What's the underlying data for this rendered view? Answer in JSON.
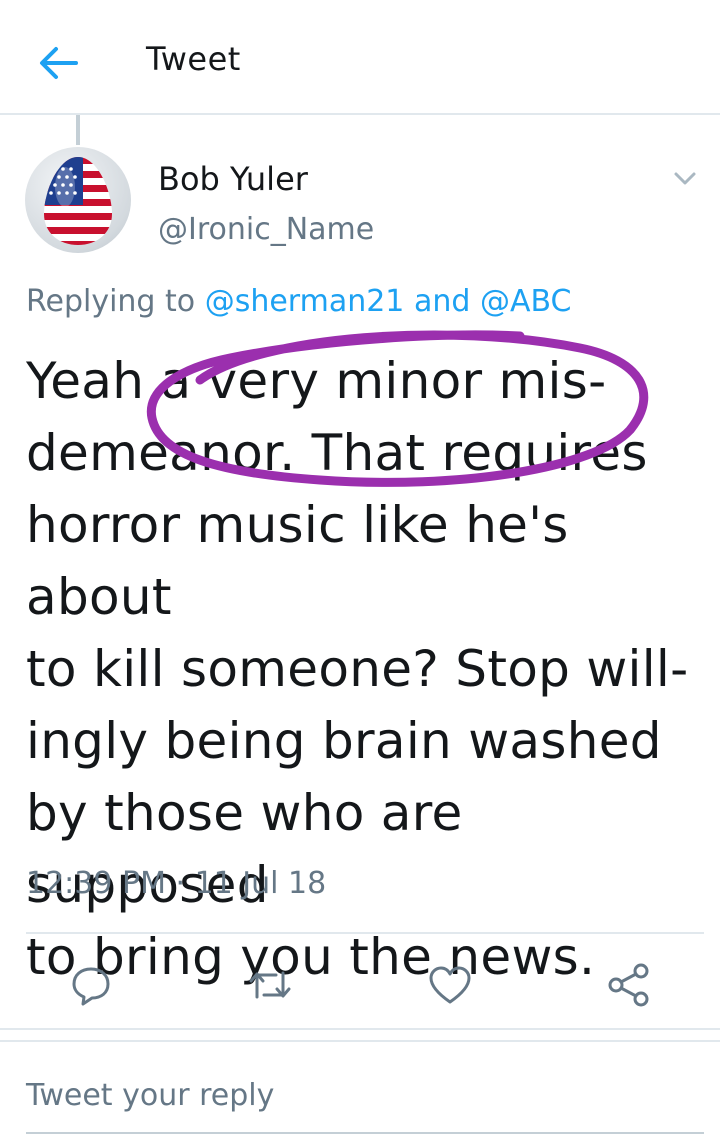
{
  "header": {
    "title": "Tweet",
    "back_icon": "arrow-left-icon",
    "accent_color": "#1da1f2"
  },
  "tweet": {
    "author": {
      "name": "Bob Yuler",
      "handle": "@Ironic_Name",
      "avatar": "american-flag-egg"
    },
    "replying_to": {
      "prefix": "Replying to",
      "mention_1": "@sherman21",
      "connector": "and",
      "mention_2": "@ABC"
    },
    "text_lines": [
      "Yeah a very minor mis-",
      "demeanor. That requires",
      "horror music like he's about",
      "to kill someone? Stop will-",
      "ingly being brain washed",
      "by those who are supposed",
      "to bring you the news."
    ],
    "timestamp": "12:39 PM · 11 Jul 18",
    "annotation_color": "#9b2fae"
  },
  "actions": [
    {
      "name": "reply",
      "icon": "reply-icon"
    },
    {
      "name": "retweet",
      "icon": "retweet-icon"
    },
    {
      "name": "like",
      "icon": "heart-icon"
    },
    {
      "name": "share",
      "icon": "share-icon"
    }
  ],
  "reply_box": {
    "placeholder": "Tweet your reply"
  }
}
